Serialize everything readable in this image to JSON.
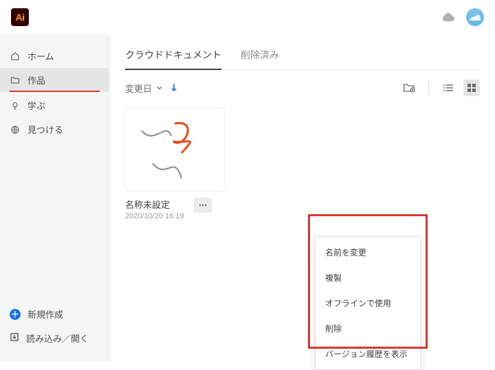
{
  "app_logo_text": "Ai",
  "sidebar": {
    "items": [
      {
        "label": "ホーム"
      },
      {
        "label": "作品"
      },
      {
        "label": "学ぶ"
      },
      {
        "label": "見つける"
      }
    ],
    "actions": {
      "new": "新規作成",
      "open": "読み込み／開く"
    }
  },
  "tabs": {
    "cloud": "クラウドドキュメント",
    "deleted": "削除済み"
  },
  "toolbar": {
    "sort_label": "変更日"
  },
  "file": {
    "title": "名称未設定",
    "date": "2020/10/20 16:19"
  },
  "context_menu": {
    "rename": "名前を変更",
    "duplicate": "複製",
    "offline": "オフラインで使用",
    "delete": "削除",
    "versions": "バージョン履歴を表示"
  }
}
